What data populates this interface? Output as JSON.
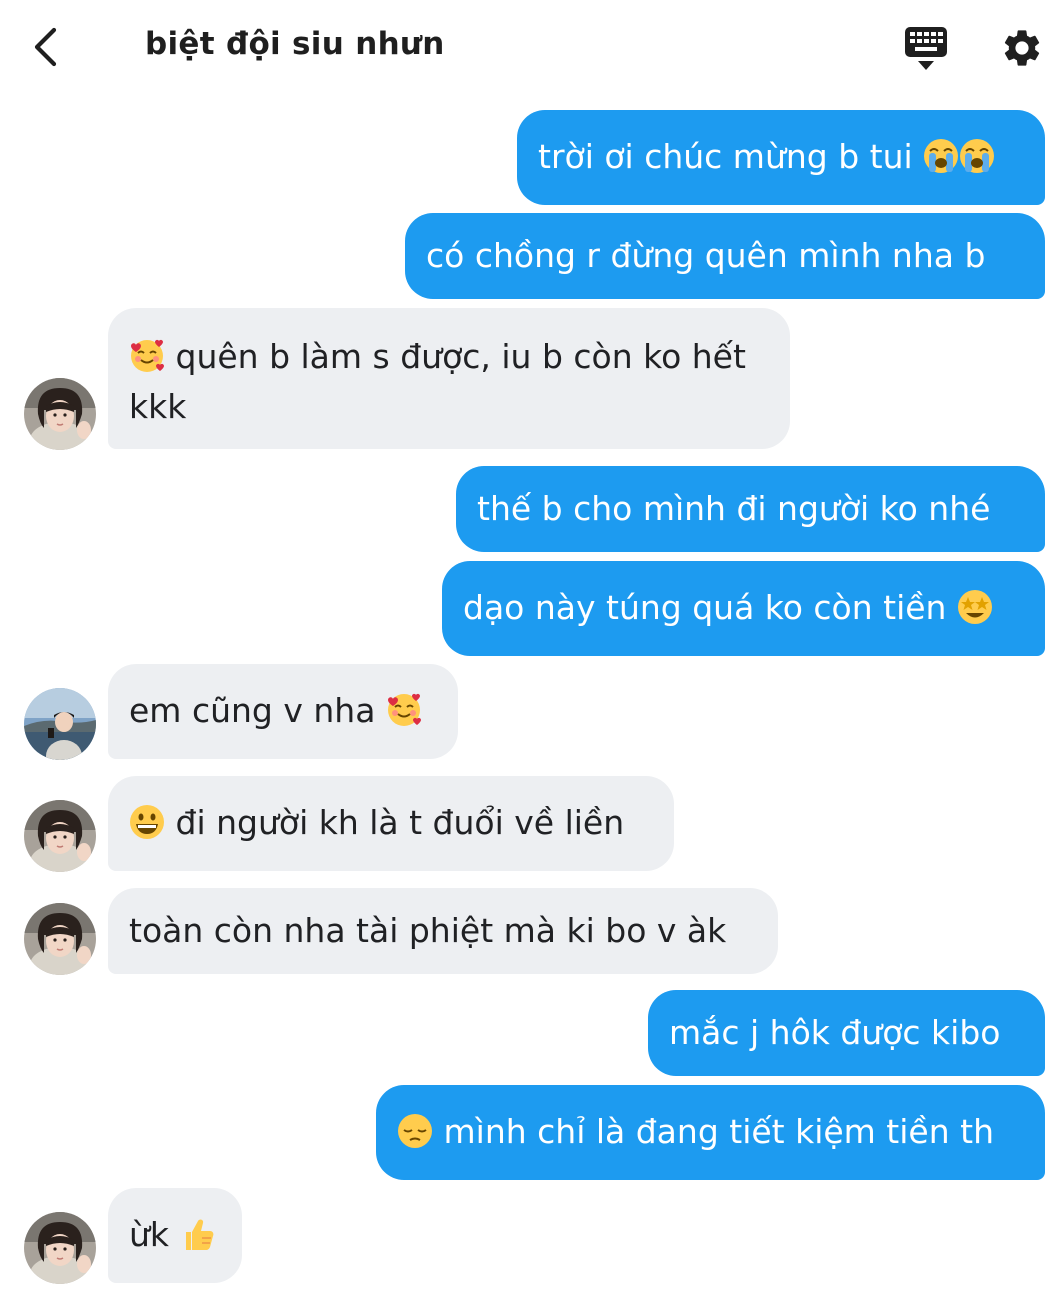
{
  "header": {
    "title": "biệt đội siu nhưn",
    "back_icon": "chevron-left-icon",
    "keyboard_icon": "keyboard-icon",
    "settings_icon": "gear-icon"
  },
  "colors": {
    "outgoing_bubble": "#1d9bf0",
    "incoming_bubble": "#edeff2",
    "outgoing_text": "#ffffff",
    "incoming_text": "#202124"
  },
  "messages": [
    {
      "dir": "out",
      "text": "trời ơi chúc mừng b tui",
      "emoji_after": [
        "loudly-crying-face",
        "loudly-crying-face"
      ]
    },
    {
      "dir": "out",
      "text": "có chồng r đừng quên mình nha b"
    },
    {
      "dir": "in",
      "sender": "avatar-girl",
      "emoji_before": "smiling-face-with-hearts",
      "text": "quên b làm s được, iu b còn ko hết kkk"
    },
    {
      "dir": "out",
      "text": "thế b cho mình đi người ko nhé"
    },
    {
      "dir": "out",
      "text": "dạo này túng quá ko còn tiền",
      "emoji_after": [
        "star-struck"
      ]
    },
    {
      "dir": "in",
      "sender": "avatar-boy",
      "text": "em cũng v nha",
      "emoji_after": [
        "smiling-face-with-hearts"
      ]
    },
    {
      "dir": "in",
      "sender": "avatar-girl",
      "emoji_before": "grinning-face",
      "text": "đi người kh là t đuổi về liền"
    },
    {
      "dir": "in",
      "sender": "avatar-girl",
      "text": "toàn còn nha tài phiệt mà ki bo v àk"
    },
    {
      "dir": "out",
      "text": "mắc j hôk được kibo"
    },
    {
      "dir": "out",
      "emoji_before": "pensive-face",
      "text": "mình chỉ là đang tiết kiệm tiền th"
    },
    {
      "dir": "in",
      "sender": "avatar-girl",
      "text": "ừk",
      "emoji_after": [
        "thumbs-up"
      ]
    }
  ]
}
